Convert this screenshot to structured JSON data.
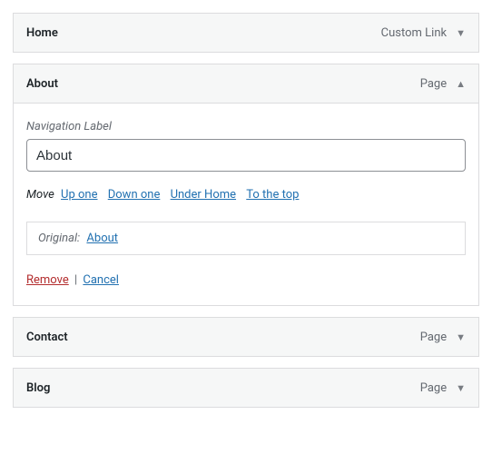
{
  "items": {
    "home": {
      "title": "Home",
      "type": "Custom Link"
    },
    "about": {
      "title": "About",
      "type": "Page",
      "nav_label_text": "Navigation Label",
      "nav_label_value": "About",
      "move_label": "Move",
      "move_links": {
        "up": "Up one",
        "down": "Down one",
        "under": "Under Home",
        "top": "To the top"
      },
      "original_label": "Original:",
      "original_link": "About",
      "remove": "Remove",
      "cancel": "Cancel"
    },
    "contact": {
      "title": "Contact",
      "type": "Page"
    },
    "blog": {
      "title": "Blog",
      "type": "Page"
    }
  }
}
